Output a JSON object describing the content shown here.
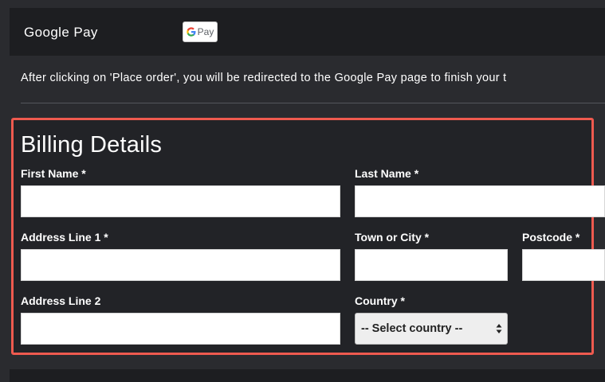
{
  "google_pay": {
    "title": "Google Pay",
    "logo_letter": "G",
    "logo_text": "Pay",
    "notice": "After clicking on 'Place order', you will be redirected to the Google Pay page to finish your t"
  },
  "billing": {
    "title": "Billing Details",
    "fields": {
      "first_name": {
        "label": "First Name *",
        "value": ""
      },
      "last_name": {
        "label": "Last Name *",
        "value": ""
      },
      "address_line_1": {
        "label": "Address Line 1 *",
        "value": ""
      },
      "town_city": {
        "label": "Town or City *",
        "value": ""
      },
      "postcode": {
        "label": "Postcode *",
        "value": ""
      },
      "address_line_2": {
        "label": "Address Line 2",
        "value": ""
      },
      "country": {
        "label": "Country *",
        "selected": "-- Select country --"
      }
    }
  },
  "colors": {
    "background": "#2a2b2f",
    "header_background": "#1d1e21",
    "highlight_border": "#ee5a4f",
    "text": "#ffffff"
  }
}
